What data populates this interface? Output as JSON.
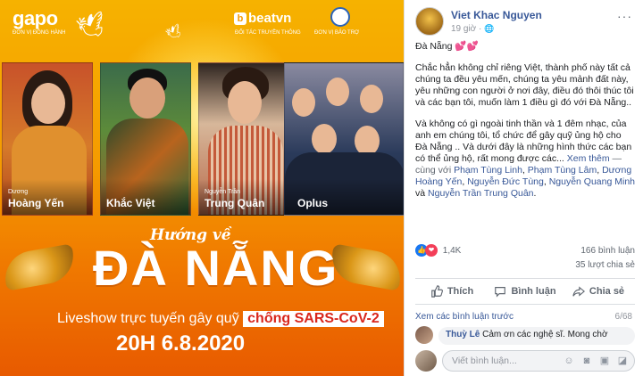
{
  "poster": {
    "brand_left": "gapo",
    "brand_left_sub": "ĐƠN VỊ ĐỒNG HÀNH",
    "brand_mid": "beatvn",
    "brand_mid_sub": "ĐỐI TÁC TRUYỀN THÔNG",
    "brand_right_sub": "ĐƠN VỊ BẢO TRỢ",
    "artists": [
      {
        "small": "Dương",
        "name": "Hoàng Yến"
      },
      {
        "small": "",
        "name": "Khắc Việt"
      },
      {
        "small": "Nguyễn Trần",
        "name": "Trung Quân"
      },
      {
        "small": "",
        "name": "Oplus"
      }
    ],
    "title_script": "Hướng về",
    "title_main": "ĐÀ NẴNG",
    "subline": "Liveshow trực tuyến gây quỹ",
    "subline_tag": "chống SARS-CoV-2",
    "date": "20H 6.8.2020"
  },
  "post": {
    "author": "Viet Khac Nguyen",
    "time": "19 giờ",
    "more": "···",
    "headline": "Đà Nẵng",
    "hearts": "💕💕",
    "paragraph1": "Chắc hẳn không chỉ riêng Việt, thành phố này tất cả chúng ta đều yêu mến, chúng ta yêu mảnh đất này, yêu những con người ở nơi đây, điều đó thôi thúc tôi và các bạn tôi, muốn làm 1 điều gì đó với Đà Nẵng..",
    "paragraph2": "Và không có gì ngoài tinh thần và 1 đêm nhạc, của anh em chúng tôi, tổ chức để gây quỹ ủng hộ cho Đà Nẵng .. Và dưới đây là những hình thức các bạn có thể ủng hộ, rất mong được các...",
    "see_more": "Xem thêm",
    "with_prefix": "— cùng với",
    "tagged": [
      "Phạm Tùng Linh",
      "Phạm Tùng Lâm",
      "Dương Hoàng Yến",
      "Nguyễn Đức Tùng",
      "Nguyễn Quang Minh",
      "Nguyễn Trần Trung Quân"
    ],
    "and_word": "và",
    "reaction_count": "1,4K",
    "comments_count": "166 bình luận",
    "shares_count": "35 lượt chia sẻ",
    "actions": {
      "like": "Thích",
      "comment": "Bình luận",
      "share": "Chia sẻ"
    },
    "view_previous": "Xem các bình luận trước",
    "page_count": "6/68",
    "comment": {
      "name": "Thuỳ Lê",
      "text": "Cảm ơn các nghệ sĩ. Mong chờ"
    },
    "composer_placeholder": "Viết bình luận..."
  },
  "colors": {
    "link": "#385898",
    "like_blue": "#1877f2",
    "love_red": "#f33e58",
    "poster_orange": "#f59a00"
  }
}
